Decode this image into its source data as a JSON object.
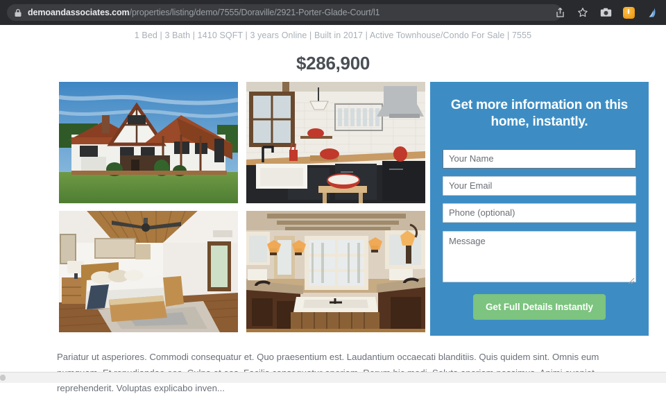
{
  "browser": {
    "url_host": "demoandassociates.com",
    "url_path": "/properties/listing/demo/7555/Doraville/2921-Porter-Glade-Court/l1",
    "lock_icon": "lock-icon",
    "actions": [
      {
        "name": "share-icon",
        "label": "Share"
      },
      {
        "name": "bookmark-star-icon",
        "label": "Bookmark"
      },
      {
        "name": "screenshot-camera-icon",
        "label": "Screenshot"
      },
      {
        "name": "extension-orange-icon",
        "label": "Extension"
      },
      {
        "name": "profile-wave-icon",
        "label": "Profile"
      }
    ]
  },
  "listing": {
    "meta": "1 Bed | 3 Bath | 1410 SQFT | 3 years Online | Built in 2017 | Active Townhouse/Condo For Sale | 7555",
    "price": "$286,900",
    "description": "Pariatur ut asperiores. Commodi consequatur et. Quo praesentium est. Laudantium occaecati blanditiis. Quis quidem sint. Omnis eum numquam. Et repudiandae eos. Culpa et eos. Facilis consequatur aperiam. Rerum hic modi. Soluta aperiam possimus. Animi eveniet reprehenderit. Voluptas explicabo inven..."
  },
  "gallery": {
    "photos": [
      {
        "name": "photo-exterior-front",
        "alt": "Tudor style house exterior with red roof and green lawn"
      },
      {
        "name": "photo-kitchen",
        "alt": "Kitchen with black cabinets, white subway tile and stainless range hood"
      },
      {
        "name": "photo-bedroom",
        "alt": "Bedroom with vaulted wood ceiling, ceiling fan and wood bed"
      },
      {
        "name": "photo-bathroom",
        "alt": "Rustic bathroom with soaking tub, window and wall sconces"
      }
    ]
  },
  "form": {
    "title": "Get more information on this home, instantly.",
    "name_placeholder": "Your Name",
    "name_value": "",
    "email_placeholder": "Your Email",
    "email_value": "",
    "phone_placeholder": "Phone (optional)",
    "phone_value": "",
    "message_placeholder": "Message",
    "message_value": "",
    "submit_label": "Get Full Details Instantly"
  },
  "colors": {
    "panel_blue": "#3d8dc4",
    "cta_green": "#7cc47f",
    "chrome_dark": "#292a2d",
    "meta_gray": "#a9b0b8",
    "price_gray": "#4a4f55"
  }
}
